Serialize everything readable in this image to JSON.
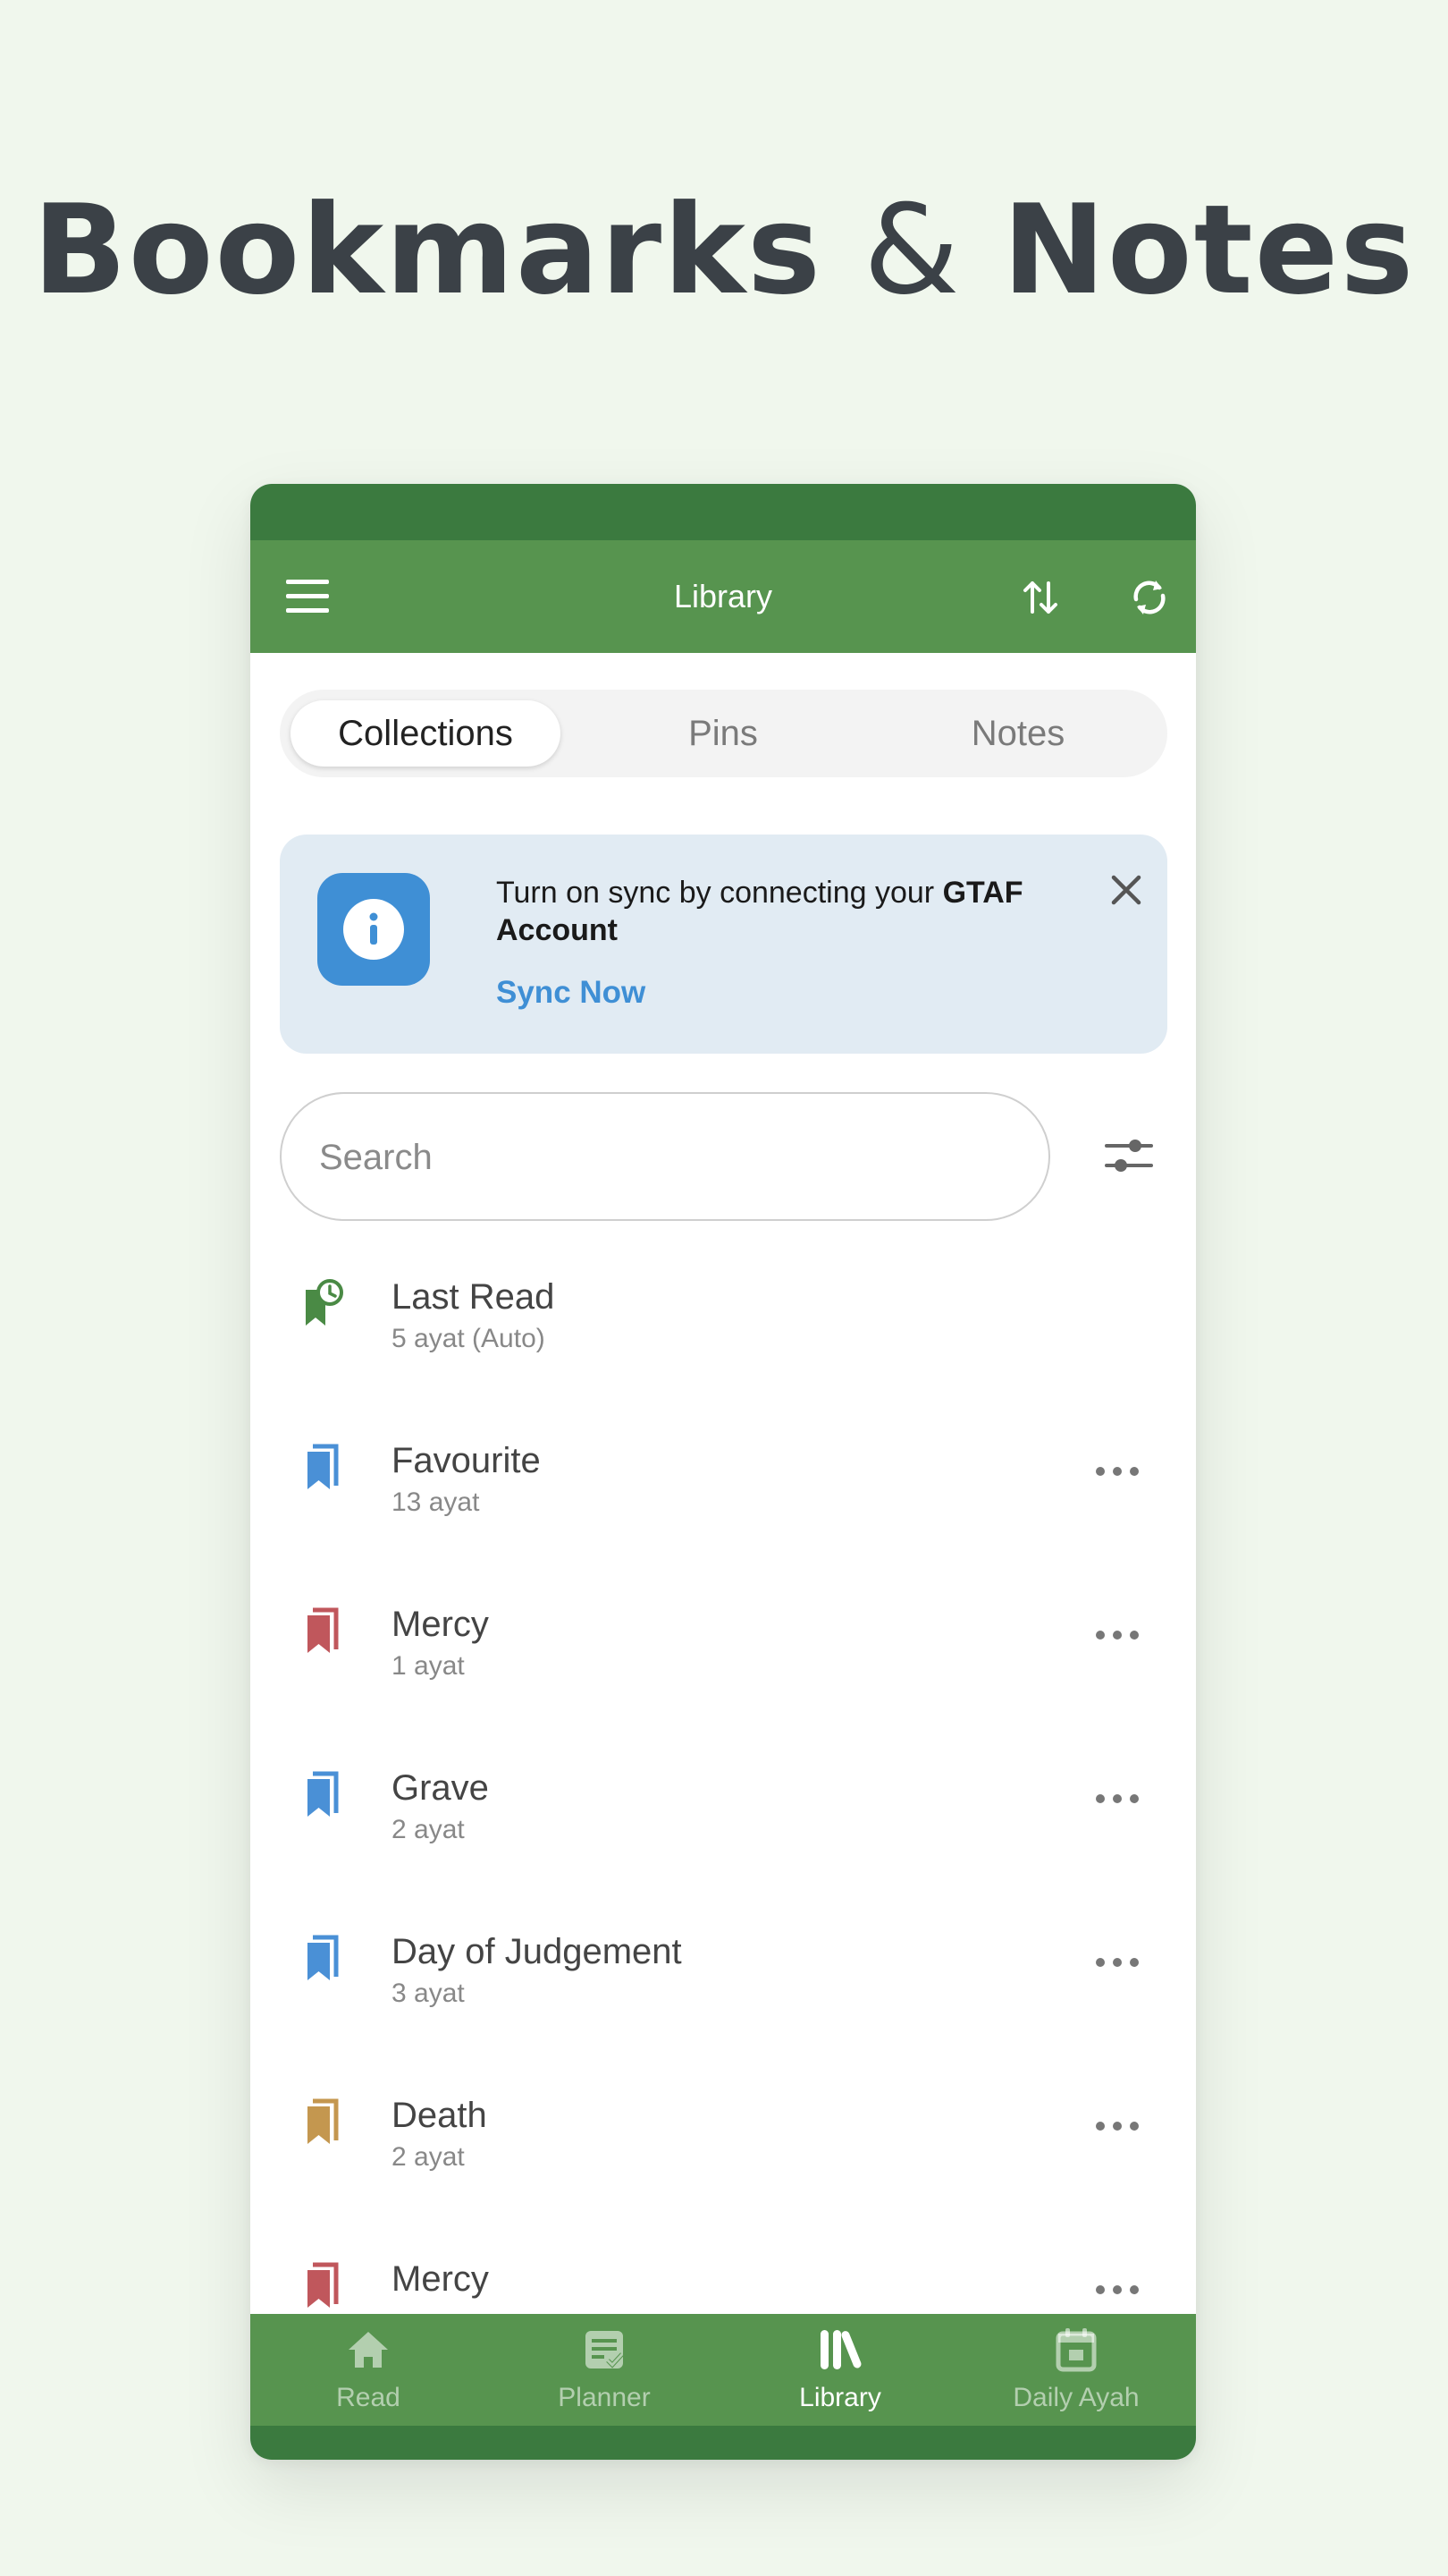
{
  "headline": {
    "word1": "Bookmarks",
    "amp": "&",
    "word2": "Notes"
  },
  "app_bar": {
    "title": "Library",
    "icons": [
      "menu-icon",
      "sort-icon",
      "sync-icon"
    ]
  },
  "tabs": [
    {
      "label": "Collections",
      "active": true
    },
    {
      "label": "Pins",
      "active": false
    },
    {
      "label": "Notes",
      "active": false
    }
  ],
  "banner": {
    "text_prefix": "Turn on sync by connecting your ",
    "text_bold": "GTAF Account",
    "action": "Sync Now",
    "icons": [
      "info-icon",
      "close-icon"
    ]
  },
  "search": {
    "placeholder": "Search",
    "value": ""
  },
  "collections": [
    {
      "name": "Last Read",
      "subtitle": "5 ayat (Auto)",
      "icon": "last-read-bookmark-icon",
      "color": "#4a8a45",
      "has_menu": false
    },
    {
      "name": "Favourite",
      "subtitle": "13 ayat",
      "icon": "bookmark-icon",
      "color": "#4a90d6",
      "has_menu": true
    },
    {
      "name": "Mercy",
      "subtitle": "1 ayat",
      "icon": "bookmark-icon",
      "color": "#c0575c",
      "has_menu": true
    },
    {
      "name": "Grave",
      "subtitle": "2 ayat",
      "icon": "bookmark-icon",
      "color": "#4a90d6",
      "has_menu": true
    },
    {
      "name": "Day of Judgement",
      "subtitle": "3 ayat",
      "icon": "bookmark-icon",
      "color": "#4a90d6",
      "has_menu": true
    },
    {
      "name": "Death",
      "subtitle": "2 ayat",
      "icon": "bookmark-icon",
      "color": "#c4974f",
      "has_menu": true
    },
    {
      "name": "Mercy",
      "subtitle": "",
      "icon": "bookmark-icon",
      "color": "#c0575c",
      "has_menu": true
    }
  ],
  "bottom_nav": [
    {
      "label": "Read",
      "icon": "home-icon",
      "active": false
    },
    {
      "label": "Planner",
      "icon": "planner-icon",
      "active": false
    },
    {
      "label": "Library",
      "icon": "library-icon",
      "active": true
    },
    {
      "label": "Daily Ayah",
      "icon": "calendar-icon",
      "active": false
    }
  ],
  "colors": {
    "background": "#f0f7ed",
    "primary_green": "#57944f",
    "dark_green": "#3b7a3f",
    "accent_blue": "#3f8fd5",
    "banner_bg": "#e1ebf3"
  }
}
